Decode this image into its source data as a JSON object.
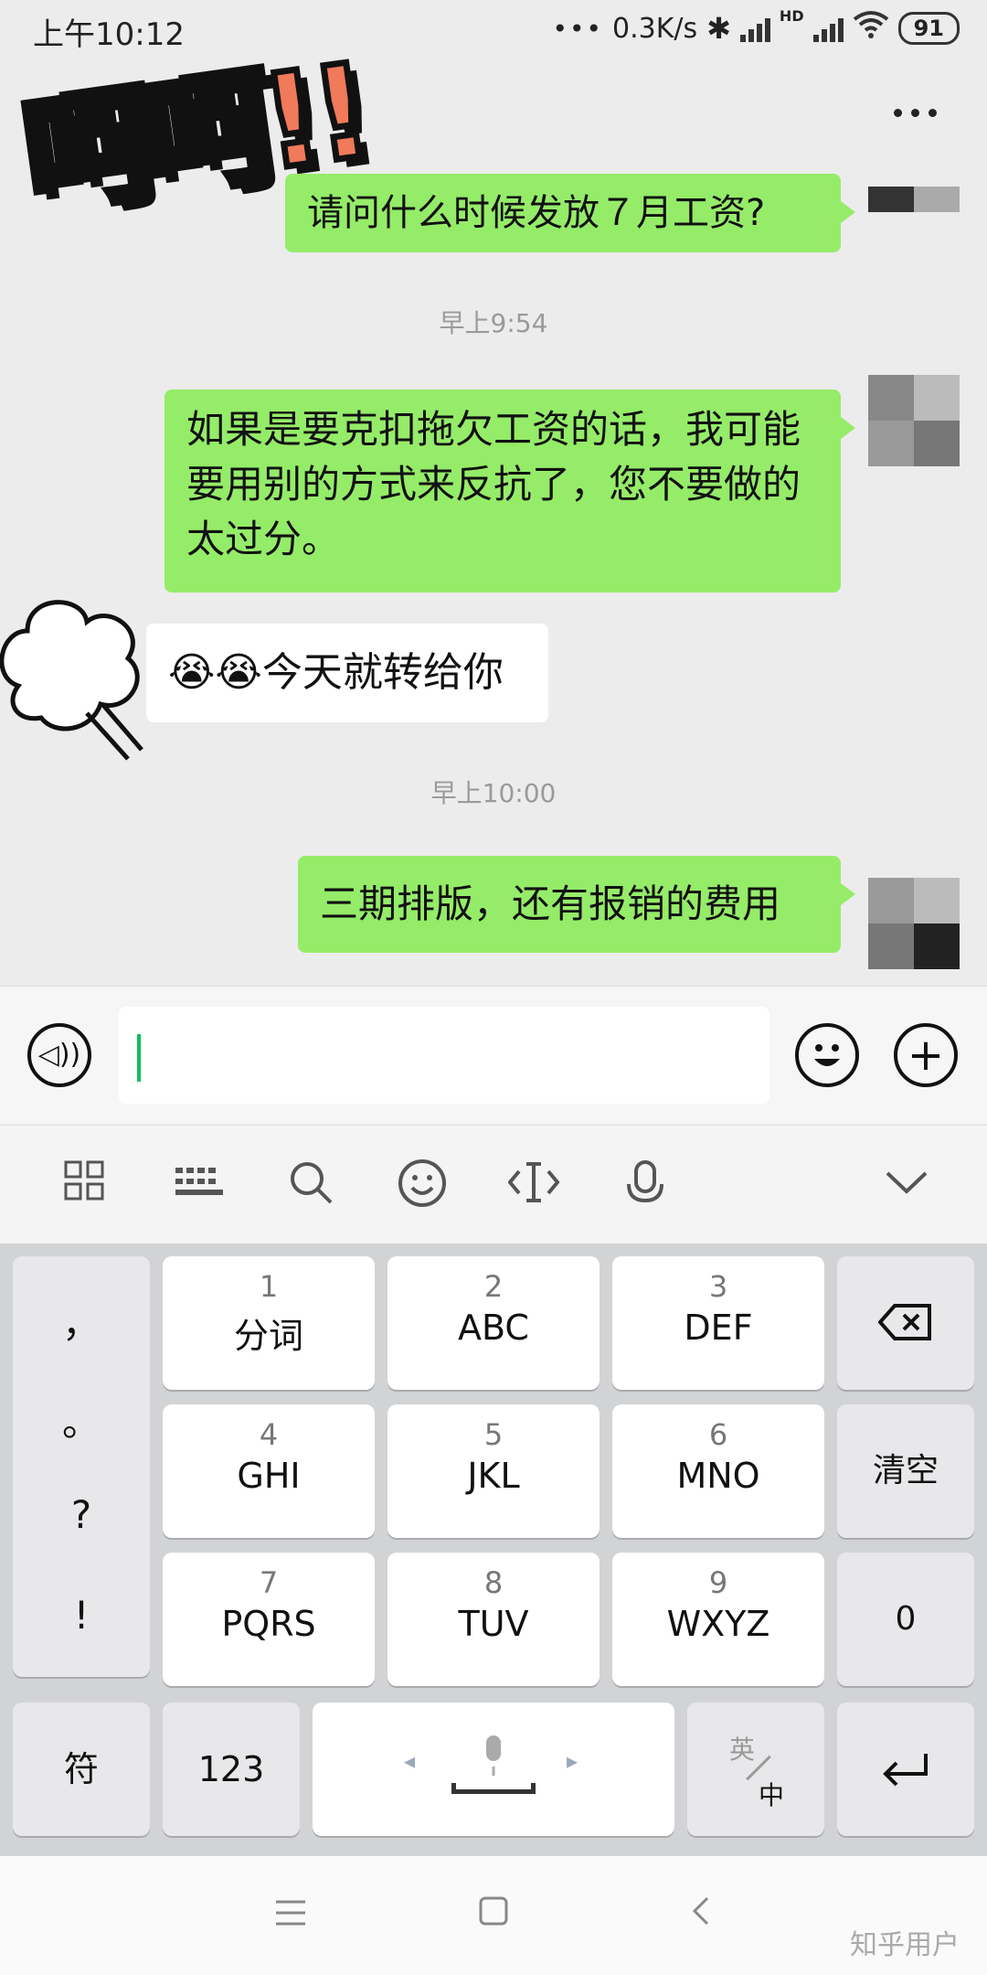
{
  "status": {
    "time": "上午10:12",
    "net_speed": "0.3K/s",
    "signal_label": "HD",
    "battery": "91"
  },
  "header": {
    "sticker_text": "呵呵!!"
  },
  "chat": {
    "messages": [
      {
        "type": "sent",
        "text": "请问什么时候发放７月工资?"
      },
      {
        "type": "time",
        "text": "早上9:54"
      },
      {
        "type": "sent",
        "text": "如果是要克扣拖欠工资的话，我可能要用别的方式来反抗了，您不要做的太过分。"
      },
      {
        "type": "received",
        "text": "😭😭今天就转给你"
      },
      {
        "type": "time",
        "text": "早上10:00"
      },
      {
        "type": "sent",
        "text": "三期排版，还有报销的费用"
      }
    ]
  },
  "input": {
    "value": ""
  },
  "keyboard": {
    "punctuation": [
      "，",
      "。",
      "?",
      "!"
    ],
    "keys": [
      {
        "num": "1",
        "letters": "分词"
      },
      {
        "num": "2",
        "letters": "ABC"
      },
      {
        "num": "3",
        "letters": "DEF"
      },
      {
        "num": "4",
        "letters": "GHI"
      },
      {
        "num": "5",
        "letters": "JKL"
      },
      {
        "num": "6",
        "letters": "MNO"
      },
      {
        "num": "7",
        "letters": "PQRS"
      },
      {
        "num": "8",
        "letters": "TUV"
      },
      {
        "num": "9",
        "letters": "WXYZ"
      }
    ],
    "clear_label": "清空",
    "zero_label": "0",
    "symbol_label": "符",
    "num_label": "123",
    "lang_top": "英",
    "lang_bottom": "中"
  },
  "icons": {
    "voice": "voice-icon",
    "emoji": "emoji-icon",
    "plus": "plus-icon",
    "grid": "grid-icon",
    "keyboard": "keyboard-icon",
    "search": "search-icon",
    "smile": "smile-icon",
    "cursor": "cursor-move-icon",
    "mic": "mic-icon",
    "collapse": "chevron-down-icon",
    "backspace": "backspace-icon",
    "enter": "enter-icon"
  },
  "colors": {
    "sent_bubble": "#95ec69",
    "received_bubble": "#ffffff",
    "cursor": "#07c160"
  },
  "watermark": "知乎用户"
}
